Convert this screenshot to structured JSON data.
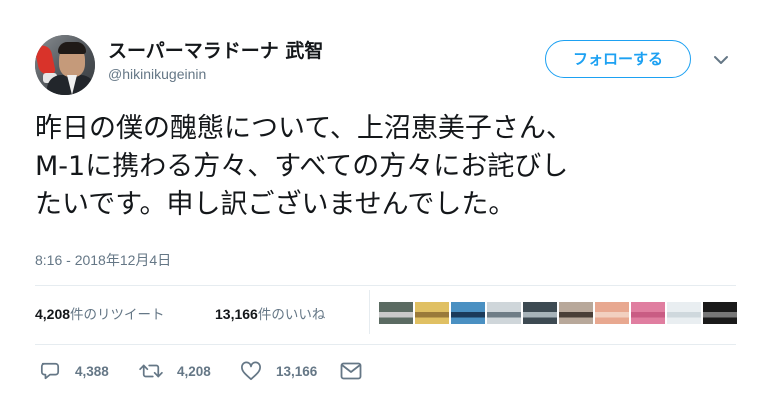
{
  "user": {
    "display_name": "スーパーマラドーナ 武智",
    "handle": "@hikinikugeinin"
  },
  "header": {
    "follow_label": "フォローする",
    "menu_icon": "chevron-down-icon"
  },
  "tweet": {
    "text_lines": [
      "昨日の僕の醜態について、上沼恵美子さん、",
      "M-1に携わる方々、すべての方々にお詫びし",
      "たいです。申し訳ございませんでした。"
    ],
    "timestamp": "8:16 - 2018年12月4日"
  },
  "stats": {
    "retweets_count": "4,208",
    "retweets_label": "件のリツイート",
    "likes_count": "13,166",
    "likes_label": "件のいいね"
  },
  "engagers": [
    {
      "name": "engager-avatar-1",
      "colors": [
        "#5b6b62",
        "#c9c9c9"
      ]
    },
    {
      "name": "engager-avatar-2",
      "colors": [
        "#e0c063",
        "#9a7a3a"
      ]
    },
    {
      "name": "engager-avatar-3",
      "colors": [
        "#4a90c2",
        "#1b3a5a"
      ]
    },
    {
      "name": "engager-avatar-4",
      "colors": [
        "#cfd6da",
        "#6f7d86"
      ]
    },
    {
      "name": "engager-avatar-5",
      "colors": [
        "#3d4a52",
        "#a7b3b9"
      ]
    },
    {
      "name": "engager-avatar-6",
      "colors": [
        "#b8a89a",
        "#4a3f37"
      ]
    },
    {
      "name": "engager-avatar-7",
      "colors": [
        "#e8a890",
        "#f2d0c0"
      ]
    },
    {
      "name": "engager-avatar-8",
      "colors": [
        "#e07ea0",
        "#c95c84"
      ]
    },
    {
      "name": "engager-avatar-9",
      "colors": [
        "#e9eef1",
        "#cfd8dd"
      ]
    },
    {
      "name": "engager-avatar-10",
      "colors": [
        "#1a1a1a",
        "#777777"
      ]
    }
  ],
  "actions": {
    "reply_count": "4,388",
    "retweet_count": "4,208",
    "like_count": "13,166",
    "reply_icon": "reply-icon",
    "retweet_icon": "retweet-icon",
    "like_icon": "heart-icon",
    "dm_icon": "envelope-icon"
  }
}
